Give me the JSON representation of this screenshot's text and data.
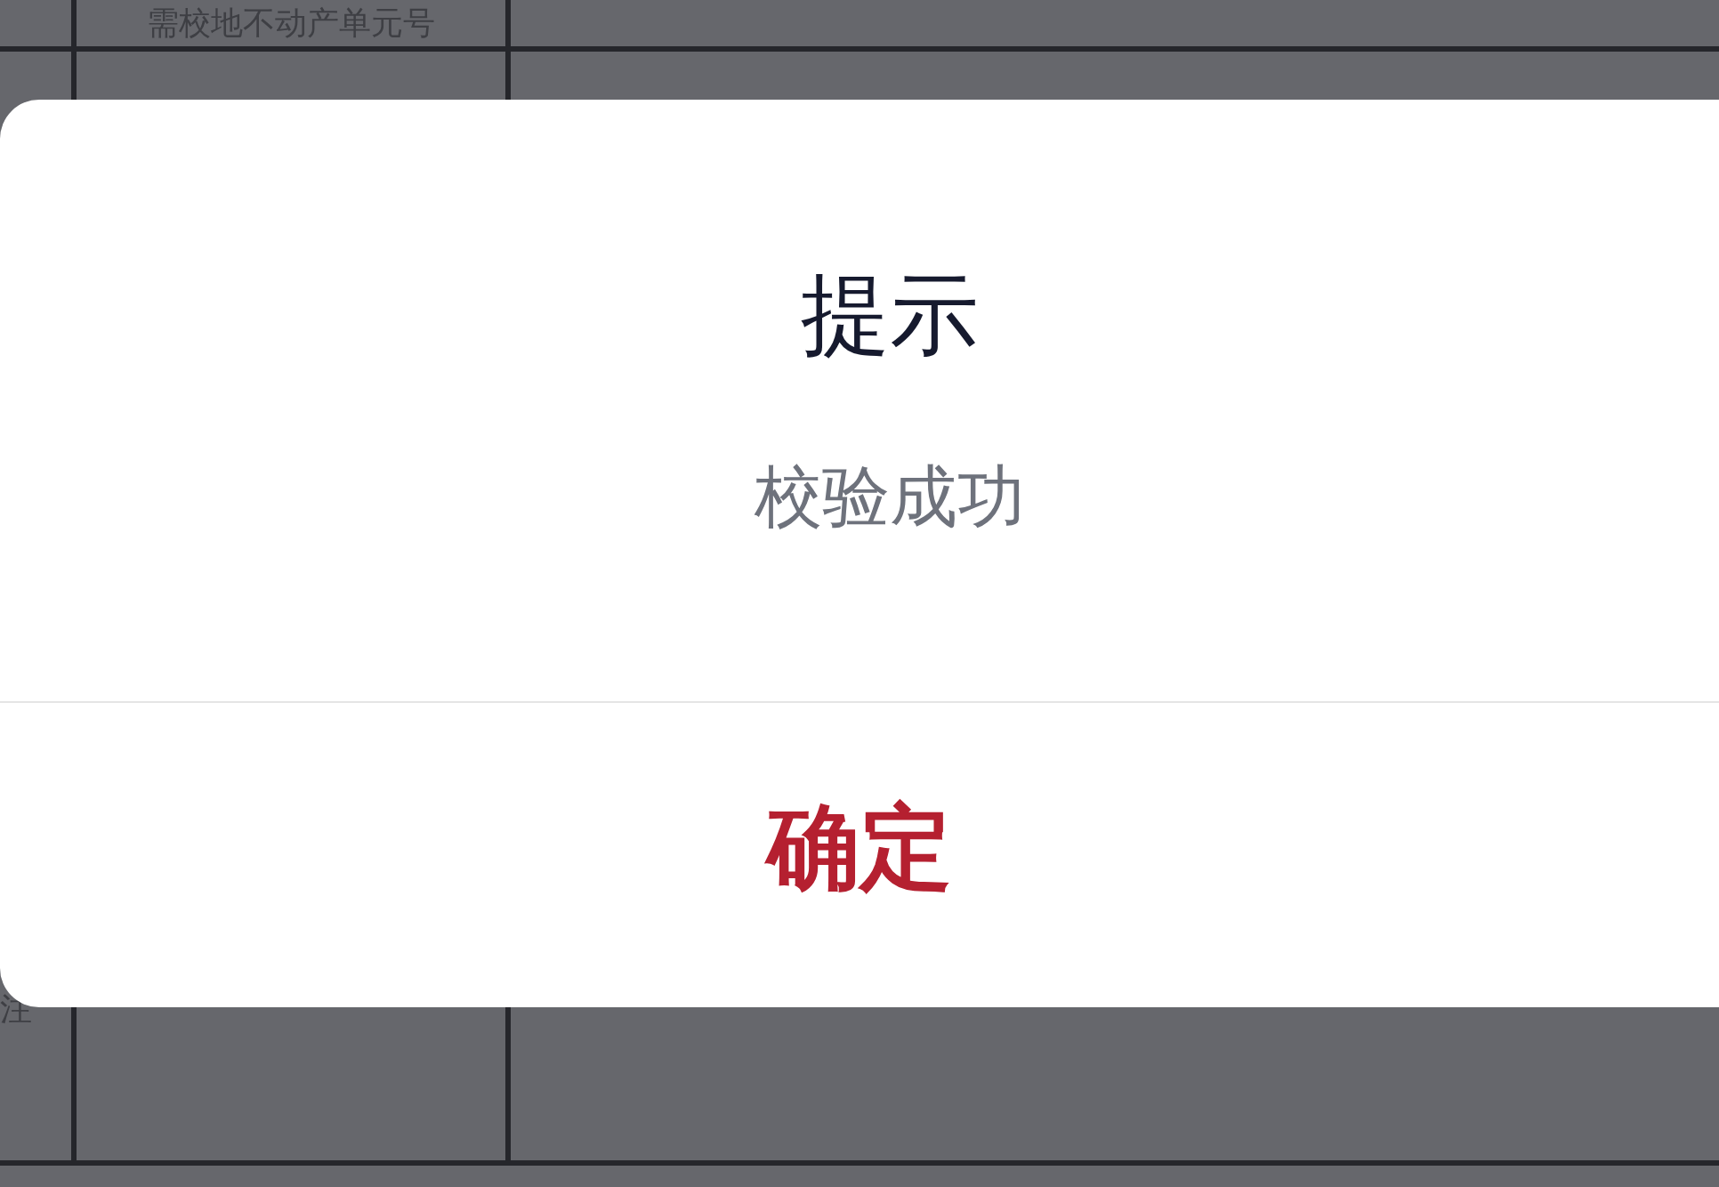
{
  "table": {
    "rows": [
      {
        "cells": [
          "",
          "需校地不动产单元号",
          ""
        ]
      },
      {
        "cells": [
          "注",
          "",
          ""
        ]
      }
    ]
  },
  "dialog": {
    "title": "提示",
    "message": "校验成功",
    "buttons": [
      "确定"
    ]
  }
}
